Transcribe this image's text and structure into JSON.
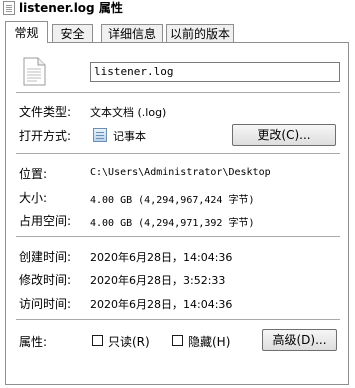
{
  "window": {
    "title": "listener.log 属性"
  },
  "tabs": [
    "常规",
    "安全",
    "详细信息",
    "以前的版本"
  ],
  "file": {
    "name": "listener.log"
  },
  "type": {
    "label": "文件类型:",
    "value": "文本文档 (.log)"
  },
  "open_with": {
    "label": "打开方式:",
    "app": "记事本",
    "button": "更改(C)..."
  },
  "location": {
    "label": "位置:",
    "value": "C:\\Users\\Administrator\\Desktop"
  },
  "size": {
    "label": "大小:",
    "value": "4.00 GB (4,294,967,424 字节)"
  },
  "size_on_disk": {
    "label": "占用空间:",
    "value": "4.00 GB (4,294,971,392 字节)"
  },
  "created": {
    "label": "创建时间:",
    "value": "2020年6月28日，14:04:36"
  },
  "modified": {
    "label": "修改时间:",
    "value": "2020年6月28日，3:52:33"
  },
  "accessed": {
    "label": "访问时间:",
    "value": "2020年6月28日，14:04:36"
  },
  "attributes": {
    "label": "属性:",
    "readonly": {
      "label": "只读(R)",
      "checked": false
    },
    "hidden": {
      "label": "隐藏(H)",
      "checked": false
    },
    "advanced_button": "高级(D)..."
  }
}
